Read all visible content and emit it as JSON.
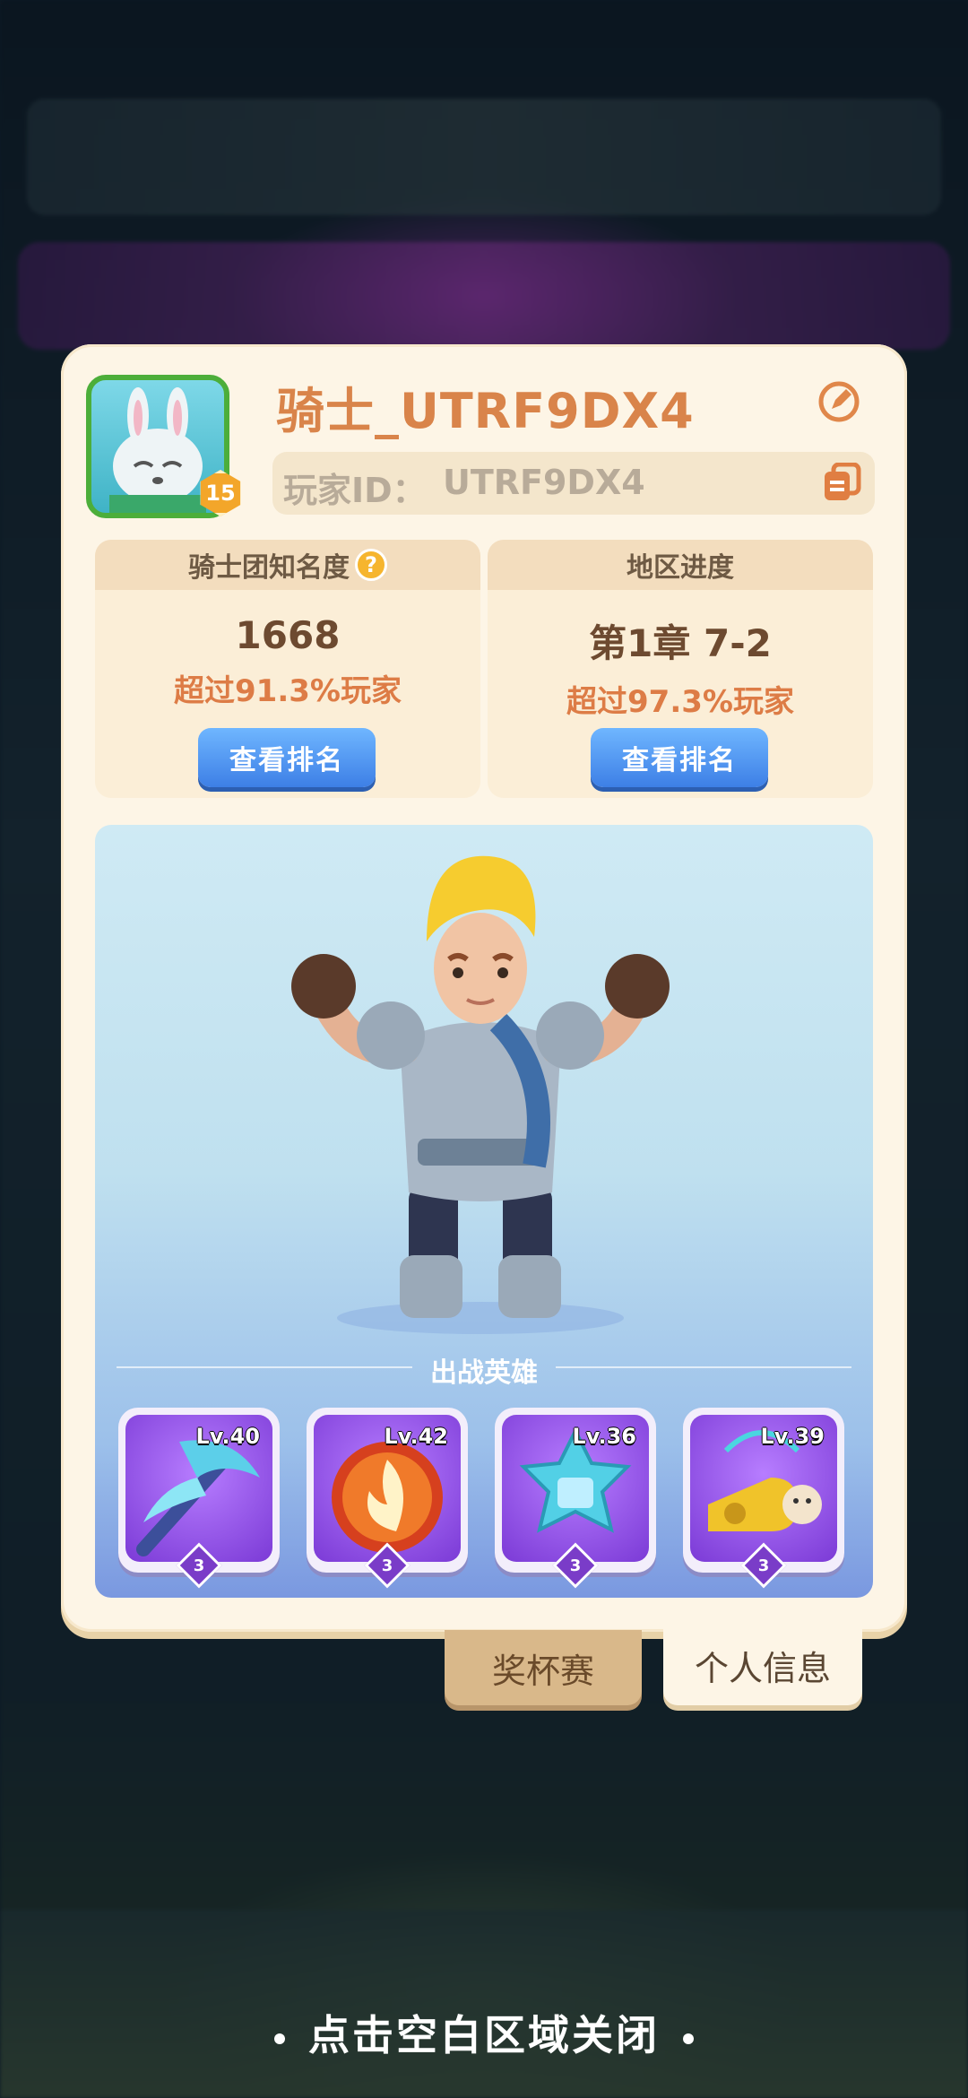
{
  "player": {
    "name": "骑士_UTRF9DX4",
    "id_label": "玩家ID：",
    "id_value": "UTRF9DX4",
    "avatar_level": "15"
  },
  "stats": [
    {
      "title": "骑士团知名度",
      "value": "1668",
      "percent_text": "超过91.3%玩家",
      "button": "查看排名",
      "has_help": true
    },
    {
      "title": "地区进度",
      "value": "第1章 7-2",
      "percent_text": "超过97.3%玩家",
      "button": "查看排名",
      "has_help": false
    }
  ],
  "hero_section": {
    "title": "出战英雄",
    "slots": [
      {
        "level": "Lv.40",
        "stars": "3",
        "icon": "ice-pickaxe-icon"
      },
      {
        "level": "Lv.42",
        "stars": "3",
        "icon": "fire-orb-icon"
      },
      {
        "level": "Lv.36",
        "stars": "3",
        "icon": "ice-star-icon"
      },
      {
        "level": "Lv.39",
        "stars": "3",
        "icon": "golden-whistle-icon"
      }
    ]
  },
  "tabs": {
    "trophy": "奖杯赛",
    "profile": "个人信息"
  },
  "close_hint": "点击空白区域关闭",
  "colors": {
    "name": "#d9844a",
    "accent_button": "#3d7fe6",
    "card_bg": "#fdf5e6"
  }
}
